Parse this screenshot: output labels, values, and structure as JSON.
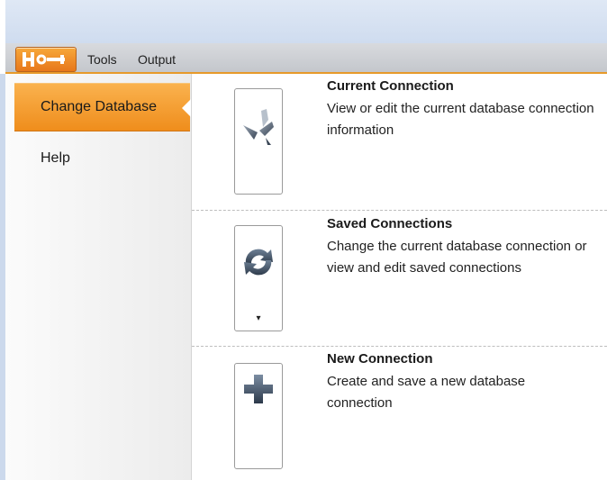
{
  "menubar": {
    "app_button_icon": "wrench-logo-icon",
    "items": [
      "Tools",
      "Output"
    ]
  },
  "sidebar": {
    "items": [
      {
        "label": "Change Database",
        "active": true
      },
      {
        "label": "Help",
        "active": false
      }
    ]
  },
  "connections": [
    {
      "title": "Current Connection",
      "description": "View or edit the current database connection information",
      "icon": "connect-plug-icon",
      "has_dropdown": false
    },
    {
      "title": "Saved Connections",
      "description": "Change the current database connection or view and edit saved connections",
      "icon": "refresh-arrows-icon",
      "has_dropdown": true,
      "dropdown_glyph": "▾"
    },
    {
      "title": "New Connection",
      "description": "Create and save a new database connection",
      "icon": "plus-icon",
      "has_dropdown": false
    }
  ],
  "colors": {
    "accent": "#ef8d1c",
    "titlebar": "#cfdcef",
    "menubar": "#c4c7cc"
  }
}
